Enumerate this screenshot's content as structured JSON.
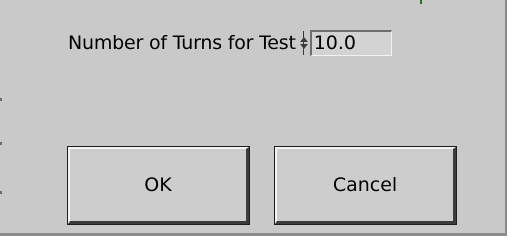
{
  "dialog": {
    "field_label": "Number of Turns for Test",
    "field_value": "10.0",
    "ok_label": "OK",
    "cancel_label": "Cancel"
  }
}
